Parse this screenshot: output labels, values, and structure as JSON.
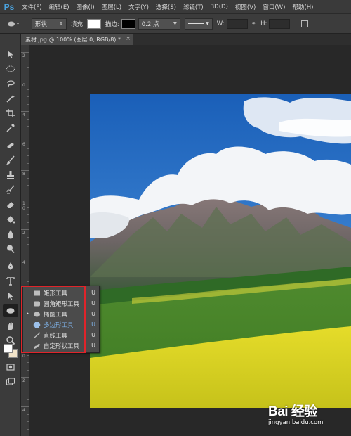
{
  "app": {
    "logo": "Ps"
  },
  "menu": [
    "文件(F)",
    "编辑(E)",
    "图像(I)",
    "图层(L)",
    "文字(Y)",
    "选择(S)",
    "滤镜(T)",
    "3D(D)",
    "视图(V)",
    "窗口(W)",
    "帮助(H)"
  ],
  "options": {
    "mode": "形状",
    "fill_label": "填充:",
    "stroke_label": "描边:",
    "stroke_width": "0.2 点",
    "w_label": "W:",
    "h_label": "H:",
    "fill_color": "#ffffff",
    "stroke_color": "#000000"
  },
  "document": {
    "tab_title": "素材.jpg @ 100% (图层 0, RGB/8) *",
    "close": "×"
  },
  "ruler": [
    "2",
    "0",
    "4",
    "6",
    "8",
    "1 0",
    "2",
    "4",
    "6",
    "8",
    "2 0",
    "2",
    "4"
  ],
  "flyout": {
    "items": [
      {
        "label": "矩形工具",
        "key": "U",
        "icon": "rectangle-icon"
      },
      {
        "label": "圆角矩形工具",
        "key": "U",
        "icon": "rounded-rectangle-icon"
      },
      {
        "label": "椭圆工具",
        "key": "U",
        "icon": "ellipse-icon",
        "bullet": "•"
      },
      {
        "label": "多边形工具",
        "key": "U",
        "icon": "polygon-icon",
        "active": true
      },
      {
        "label": "直线工具",
        "key": "U",
        "icon": "line-icon"
      },
      {
        "label": "自定形状工具",
        "key": "U",
        "icon": "custom-shape-icon"
      }
    ]
  },
  "watermark": {
    "logo": "Bai 经验",
    "url": "jingyan.baidu.com"
  },
  "colors": {
    "highlight": "#e0242a",
    "active_item": "#7fb2e8",
    "accent": "#4aa3df"
  }
}
